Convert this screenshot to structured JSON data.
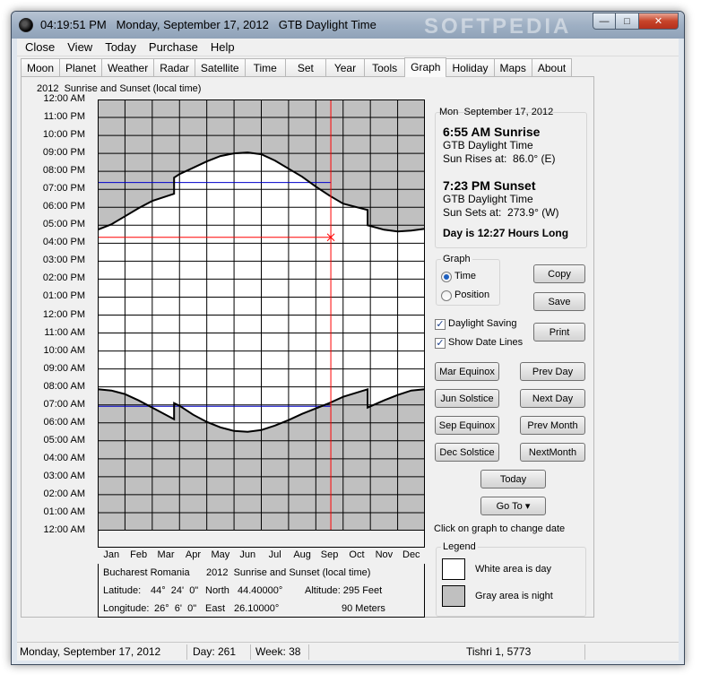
{
  "titlebar": {
    "time": "04:19:51 PM",
    "date": "Monday, September 17, 2012",
    "timezone": "GTB Daylight Time",
    "watermark": "SOFTPEDIA"
  },
  "window_buttons": {
    "minimize": "—",
    "maximize": "□",
    "close": "✕"
  },
  "menu": [
    "Close",
    "View",
    "Today",
    "Purchase",
    "Help"
  ],
  "tabs": [
    "Moon",
    "Planet",
    "Weather",
    "Radar",
    "Satellite",
    "Time",
    "Set",
    "Year",
    "Tools",
    "Graph",
    "Holiday",
    "Maps",
    "About"
  ],
  "active_tab": "Graph",
  "chart_data": {
    "type": "area",
    "title": "2012  Sunrise and Sunset (local time)",
    "y_ticks": [
      "12:00 AM",
      "01:00 AM",
      "02:00 AM",
      "03:00 AM",
      "04:00 AM",
      "05:00 AM",
      "06:00 AM",
      "07:00 AM",
      "08:00 AM",
      "09:00 AM",
      "10:00 AM",
      "11:00 AM",
      "12:00 PM",
      "01:00 PM",
      "02:00 PM",
      "03:00 PM",
      "04:00 PM",
      "05:00 PM",
      "06:00 PM",
      "07:00 PM",
      "08:00 PM",
      "09:00 PM",
      "10:00 PM",
      "11:00 PM",
      "12:00 AM"
    ],
    "ylim": [
      0,
      24
    ],
    "xlim": [
      0,
      12
    ],
    "x_ticks": [
      "Jan",
      "Feb",
      "Mar",
      "Apr",
      "May",
      "Jun",
      "Jul",
      "Aug",
      "Sep",
      "Oct",
      "Nov",
      "Dec"
    ],
    "sunrise": [
      {
        "month": 0.0,
        "hour": 7.87
      },
      {
        "month": 0.5,
        "hour": 7.8
      },
      {
        "month": 1.0,
        "hour": 7.6
      },
      {
        "month": 1.5,
        "hour": 7.25
      },
      {
        "month": 2.0,
        "hour": 6.85
      },
      {
        "month": 2.8,
        "hour": 6.2
      },
      {
        "month": 2.8,
        "hour": 7.1
      },
      {
        "month": 3.0,
        "hour": 6.95
      },
      {
        "month": 3.5,
        "hour": 6.45
      },
      {
        "month": 4.0,
        "hour": 6.05
      },
      {
        "month": 4.5,
        "hour": 5.75
      },
      {
        "month": 5.0,
        "hour": 5.55
      },
      {
        "month": 5.5,
        "hour": 5.5
      },
      {
        "month": 6.0,
        "hour": 5.6
      },
      {
        "month": 6.5,
        "hour": 5.85
      },
      {
        "month": 7.0,
        "hour": 6.15
      },
      {
        "month": 7.5,
        "hour": 6.5
      },
      {
        "month": 8.0,
        "hour": 6.8
      },
      {
        "month": 8.5,
        "hour": 7.1
      },
      {
        "month": 9.0,
        "hour": 7.45
      },
      {
        "month": 9.9,
        "hour": 7.87
      },
      {
        "month": 9.9,
        "hour": 6.85
      },
      {
        "month": 10.5,
        "hour": 7.25
      },
      {
        "month": 11.0,
        "hour": 7.55
      },
      {
        "month": 11.5,
        "hour": 7.8
      },
      {
        "month": 12.0,
        "hour": 7.87
      }
    ],
    "sunset": [
      {
        "month": 0.0,
        "hour": 16.75
      },
      {
        "month": 0.5,
        "hour": 17.05
      },
      {
        "month": 1.0,
        "hour": 17.5
      },
      {
        "month": 1.5,
        "hour": 17.95
      },
      {
        "month": 2.0,
        "hour": 18.35
      },
      {
        "month": 2.8,
        "hour": 18.75
      },
      {
        "month": 2.8,
        "hour": 19.65
      },
      {
        "month": 3.0,
        "hour": 19.85
      },
      {
        "month": 3.5,
        "hour": 20.2
      },
      {
        "month": 4.0,
        "hour": 20.55
      },
      {
        "month": 4.5,
        "hour": 20.85
      },
      {
        "month": 5.0,
        "hour": 21.0
      },
      {
        "month": 5.5,
        "hour": 21.05
      },
      {
        "month": 6.0,
        "hour": 20.95
      },
      {
        "month": 6.5,
        "hour": 20.6
      },
      {
        "month": 7.0,
        "hour": 20.15
      },
      {
        "month": 7.5,
        "hour": 19.7
      },
      {
        "month": 8.0,
        "hour": 19.15
      },
      {
        "month": 8.5,
        "hour": 18.65
      },
      {
        "month": 9.0,
        "hour": 18.2
      },
      {
        "month": 9.9,
        "hour": 17.85
      },
      {
        "month": 9.9,
        "hour": 17.0
      },
      {
        "month": 10.5,
        "hour": 16.75
      },
      {
        "month": 11.0,
        "hour": 16.65
      },
      {
        "month": 11.5,
        "hour": 16.7
      },
      {
        "month": 12.0,
        "hour": 16.8
      }
    ],
    "current_date_month": 8.55,
    "current_time_hour": 16.33,
    "sunrise_ref_hour": 6.92,
    "sunset_ref_hour": 19.38,
    "sunset_ref_extent_month": 8.55,
    "colors": {
      "night": "#c0c0c0",
      "day": "#ffffff",
      "grid": "#000000",
      "cursor": "#ff0000",
      "reference": "#0000cc"
    }
  },
  "info": {
    "location": "Bucharest Romania",
    "caption": "2012  Sunrise and Sunset (local time)",
    "lat_label": "Latitude:",
    "lat_dms": "44°  24'  0\"",
    "lat_dir": "North",
    "lat_dec": "44.40000°",
    "alt_label": "Altitude: 295 Feet",
    "lon_label": "Longitude:",
    "lon_dms": "26°  6'  0\"",
    "lon_dir": "East",
    "lon_dec": "26.10000°",
    "alt_meters": "90 Meters"
  },
  "sun": {
    "date": "Mon  September 17, 2012",
    "sunrise": "6:55 AM Sunrise",
    "rise_tz": "GTB Daylight Time",
    "rise_az": "Sun Rises at:  86.0° (E)",
    "sunset": "7:23 PM Sunset",
    "set_tz": "GTB Daylight Time",
    "set_az": "Sun Sets at:  273.9° (W)",
    "daylen": "Day is 12:27 Hours Long"
  },
  "graph_group": {
    "label": "Graph",
    "opt_time": "Time",
    "opt_position": "Position",
    "selected": "Time"
  },
  "buttons": {
    "copy": "Copy",
    "save": "Save",
    "print": "Print",
    "mar_equinox": "Mar Equinox",
    "prev_day": "Prev Day",
    "jun_solstice": "Jun Solstice",
    "next_day": "Next Day",
    "sep_equinox": "Sep Equinox",
    "prev_month": "Prev Month",
    "dec_solstice": "Dec Solstice",
    "next_month": "NextMonth",
    "today": "Today",
    "goto": "Go To ▾"
  },
  "checks": {
    "daylight_saving": "Daylight Saving",
    "show_date_lines": "Show Date Lines",
    "check_glyph": "✓"
  },
  "hint": "Click on graph to change date",
  "legend": {
    "label": "Legend",
    "day": "White area is day",
    "night": "Gray area is night"
  },
  "status": {
    "date": "Monday, September 17, 2012",
    "day": "Day: 261",
    "week": "Week: 38",
    "hebrew": "Tishri 1, 5773"
  }
}
